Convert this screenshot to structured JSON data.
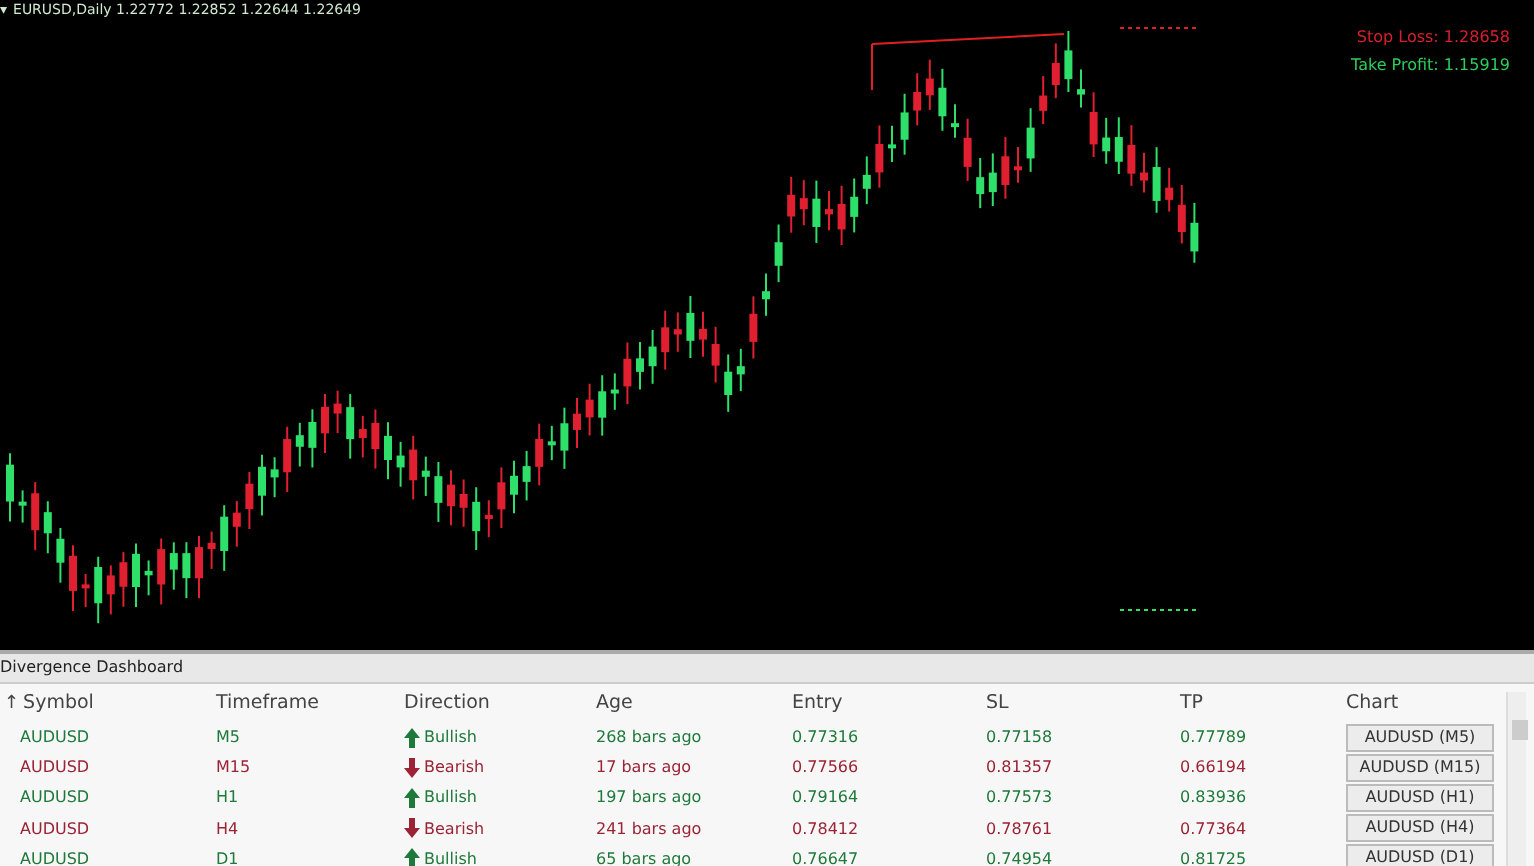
{
  "chart": {
    "menu_icon": "▾",
    "symbol_info": "EURUSD,Daily  1.22772 1.22852 1.22644 1.22649",
    "stop_loss": "Stop Loss: 1.28658",
    "take_profit": "Take Profit: 1.15919"
  },
  "dashboard": {
    "title": "Divergence Dashboard",
    "columns": [
      "Symbol",
      "Timeframe",
      "Direction",
      "Age",
      "Entry",
      "SL",
      "TP",
      "Chart"
    ],
    "sort_icon": "↑",
    "rows": [
      {
        "kind": "bullish",
        "symbol": "AUDUSD",
        "timeframe": "M5",
        "direction": "Bullish",
        "age": "268 bars ago",
        "entry": "0.77316",
        "sl": "0.77158",
        "tp": "0.77789",
        "chart": "AUDUSD (M5)"
      },
      {
        "kind": "bearish",
        "symbol": "AUDUSD",
        "timeframe": "M15",
        "direction": "Bearish",
        "age": "17 bars ago",
        "entry": "0.77566",
        "sl": "0.81357",
        "tp": "0.66194",
        "chart": "AUDUSD (M15)"
      },
      {
        "kind": "bullish",
        "symbol": "AUDUSD",
        "timeframe": "H1",
        "direction": "Bullish",
        "age": "197 bars ago",
        "entry": "0.79164",
        "sl": "0.77573",
        "tp": "0.83936",
        "chart": "AUDUSD (H1)"
      },
      {
        "kind": "bearish",
        "symbol": "AUDUSD",
        "timeframe": "H4",
        "direction": "Bearish",
        "age": "241 bars ago",
        "entry": "0.78412",
        "sl": "0.78761",
        "tp": "0.77364",
        "chart": "AUDUSD (H4)"
      },
      {
        "kind": "bullish",
        "symbol": "AUDUSD",
        "timeframe": "D1",
        "direction": "Bullish",
        "age": "65 bars ago",
        "entry": "0.76647",
        "sl": "0.74954",
        "tp": "0.81725",
        "chart": "AUDUSD (D1)"
      }
    ]
  }
}
